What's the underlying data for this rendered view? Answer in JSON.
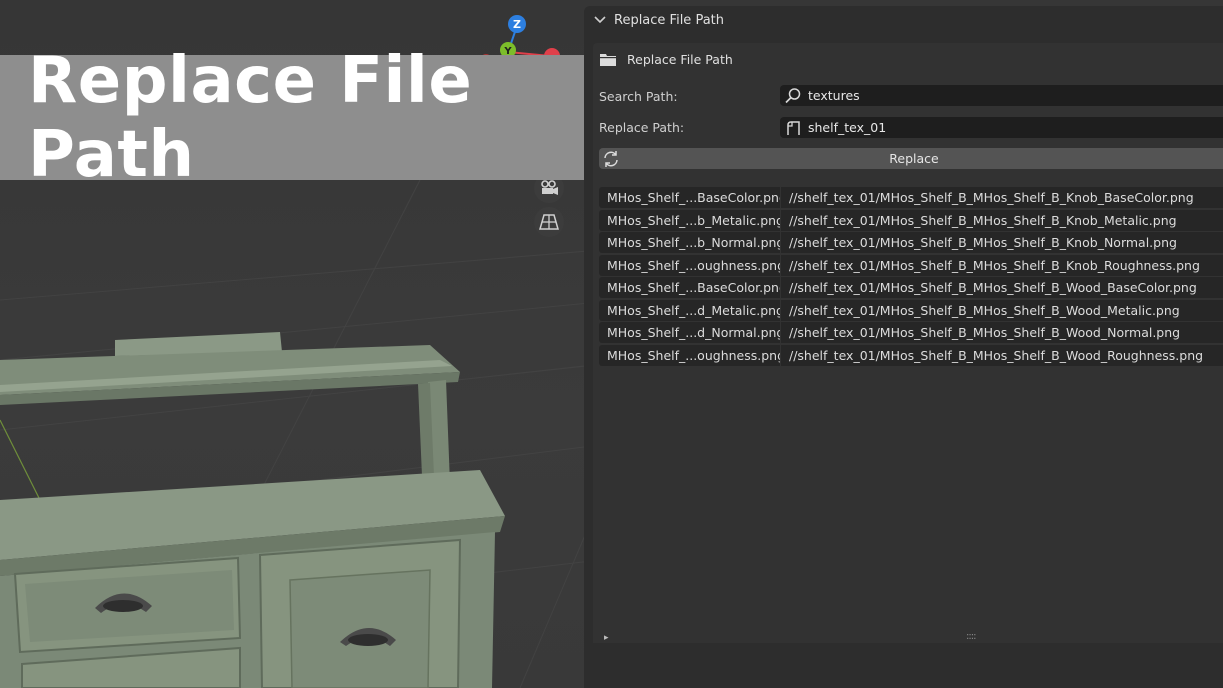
{
  "window": {
    "title": "Replace File Path"
  },
  "overlay": {
    "title": "Replace File Path"
  },
  "gizmo": {
    "z_label": "Z",
    "y_label": "Y",
    "x_label": ""
  },
  "panel": {
    "header": "Replace File Path",
    "subheader": "Replace File Path",
    "search": {
      "label": "Search Path:",
      "value": "textures",
      "icon": "search-icon"
    },
    "replace_path": {
      "label": "Replace Path:",
      "value": "shelf_tex_01",
      "icon": "file-path-icon"
    },
    "replace_button": {
      "label": "Replace",
      "icon": "refresh-icon"
    },
    "files": [
      {
        "name": "MHos_Shelf_...BaseColor.png",
        "path": "//shelf_tex_01/MHos_Shelf_B_MHos_Shelf_B_Knob_BaseColor.png"
      },
      {
        "name": "MHos_Shelf_...b_Metalic.png",
        "path": "//shelf_tex_01/MHos_Shelf_B_MHos_Shelf_B_Knob_Metalic.png"
      },
      {
        "name": "MHos_Shelf_...b_Normal.png",
        "path": "//shelf_tex_01/MHos_Shelf_B_MHos_Shelf_B_Knob_Normal.png"
      },
      {
        "name": "MHos_Shelf_...oughness.png",
        "path": "//shelf_tex_01/MHos_Shelf_B_MHos_Shelf_B_Knob_Roughness.png"
      },
      {
        "name": "MHos_Shelf_...BaseColor.png",
        "path": "//shelf_tex_01/MHos_Shelf_B_MHos_Shelf_B_Wood_BaseColor.png"
      },
      {
        "name": "MHos_Shelf_...d_Metalic.png",
        "path": "//shelf_tex_01/MHos_Shelf_B_MHos_Shelf_B_Wood_Metalic.png"
      },
      {
        "name": "MHos_Shelf_...d_Normal.png",
        "path": "//shelf_tex_01/MHos_Shelf_B_MHos_Shelf_B_Wood_Normal.png"
      },
      {
        "name": "MHos_Shelf_...oughness.png",
        "path": "//shelf_tex_01/MHos_Shelf_B_MHos_Shelf_B_Wood_Roughness.png"
      }
    ],
    "footer_arrow": "▸",
    "footer_grip": "::::"
  },
  "colors": {
    "axis_z": "#2d7fe0",
    "axis_y": "#7cbd2a",
    "axis_x": "#e0404a",
    "shelf": "#7c8a78",
    "panel_bg": "#2d2d2d",
    "button": "#545454"
  }
}
